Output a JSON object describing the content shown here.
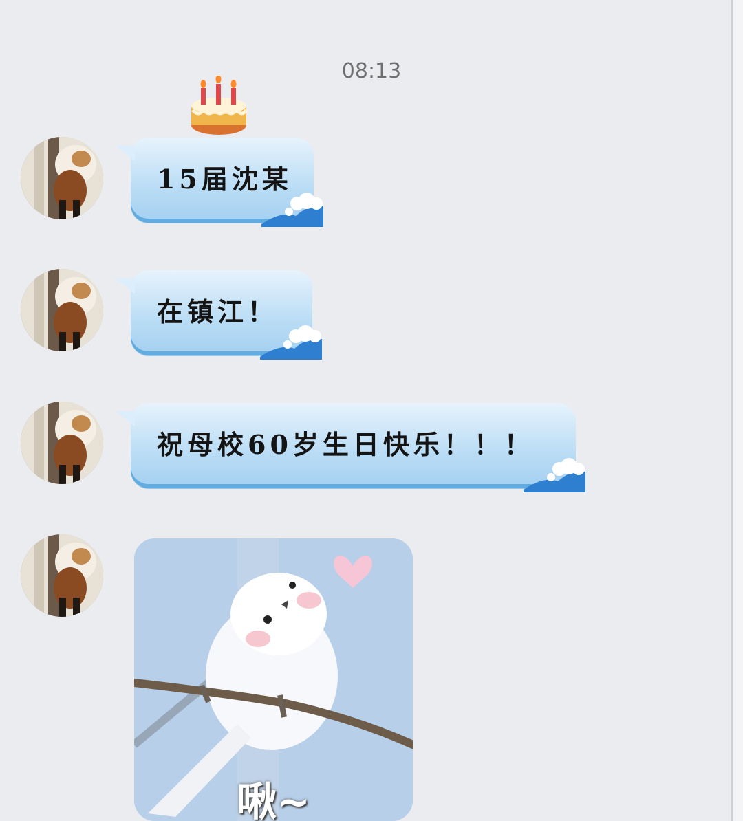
{
  "chat": {
    "timestamp": "08:13",
    "messages": [
      {
        "type": "text",
        "text": "15届沈某"
      },
      {
        "type": "text",
        "text": "在镇江！"
      },
      {
        "type": "text",
        "text": "祝母校60岁生日快乐！！！"
      },
      {
        "type": "sticker",
        "caption": "啾~"
      }
    ]
  },
  "icons": {
    "bubble_decoration": "cake-icon",
    "bubble_corner": "wave-icon",
    "avatar": "red-panda-avatar"
  },
  "colors": {
    "background": "#ebecf0",
    "bubble_light": "#e7f3fc",
    "bubble_dark": "#63acdf",
    "timestamp": "#6f6f6f"
  }
}
